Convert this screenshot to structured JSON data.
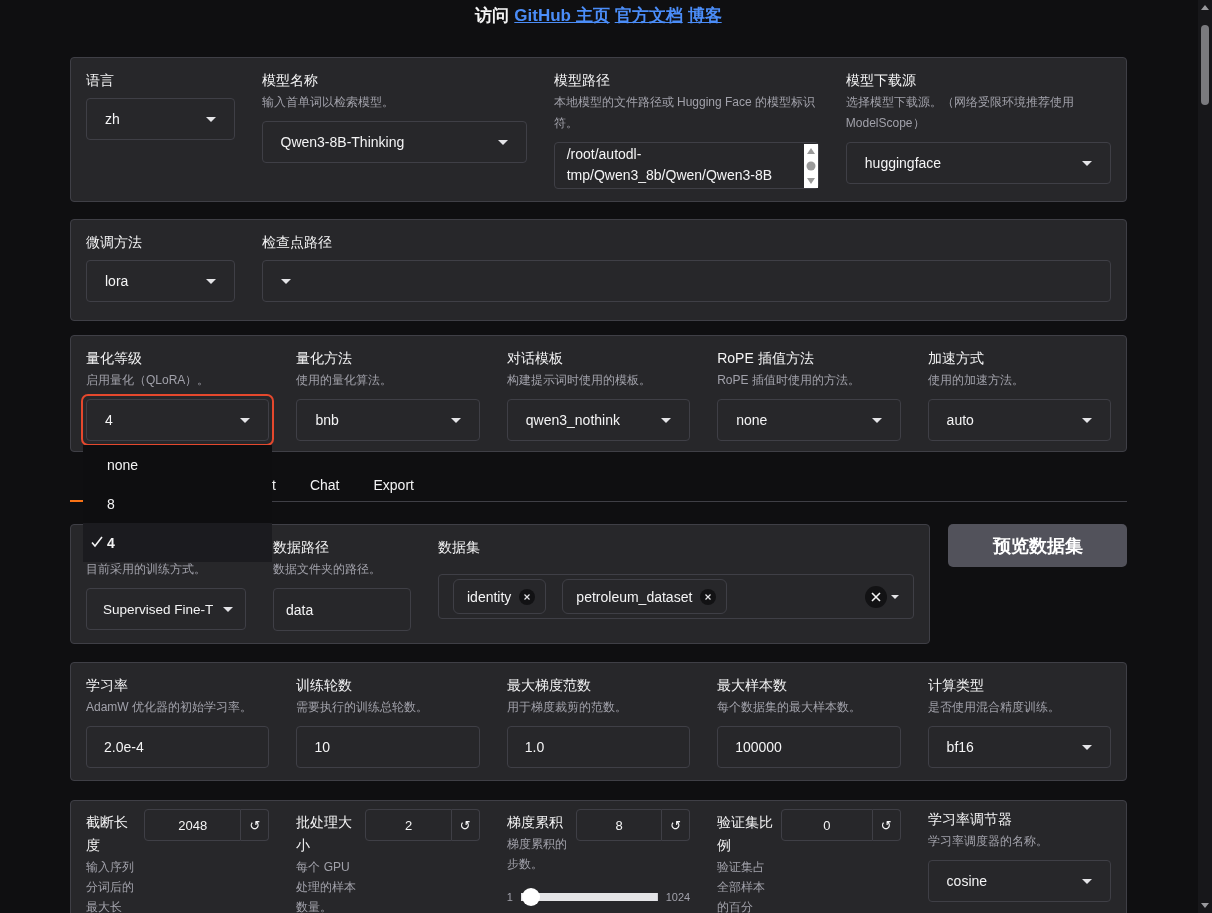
{
  "header": {
    "text": "访问",
    "links": [
      "GitHub 主页",
      "官方文档",
      "博客"
    ]
  },
  "config_panels": [
    {
      "fields": [
        {
          "kind": "select",
          "label": "语言",
          "value": "zh"
        },
        {
          "kind": "select",
          "label": "模型名称",
          "description": "输入首单词以检索模型。",
          "value": "Qwen3-8B-Thinking"
        },
        {
          "kind": "textarea",
          "label": "模型路径",
          "description": "本地模型的文件路径或 Hugging Face 的模型标识符。",
          "value": "/root/autodl-tmp/Qwen3_8b/Qwen/Qwen3-8B"
        },
        {
          "kind": "select",
          "label": "模型下载源",
          "description": "选择模型下载源。（网络受限环境推荐使用 ModelScope）",
          "value": "huggingface"
        }
      ]
    },
    {
      "fields": [
        {
          "kind": "select",
          "label": "微调方法",
          "value": "lora"
        },
        {
          "kind": "select",
          "label": "检查点路径"
        }
      ]
    },
    {
      "fields": [
        {
          "kind": "select",
          "label": "量化等级",
          "description": "启用量化（QLoRA）。",
          "value": "4",
          "highlighted": true,
          "open": true,
          "options": [
            {
              "label": "none",
              "selected": false
            },
            {
              "label": "8",
              "selected": false
            },
            {
              "label": "4",
              "selected": true
            }
          ]
        },
        {
          "kind": "select",
          "label": "量化方法",
          "description": "使用的量化算法。",
          "value": "bnb"
        },
        {
          "kind": "select",
          "label": "对话模板",
          "description": "构建提示词时使用的模板。",
          "value": "qwen3_nothink"
        },
        {
          "kind": "select",
          "label": "RoPE 插值方法",
          "description": "RoPE 插值时使用的方法。",
          "value": "none"
        },
        {
          "kind": "select",
          "label": "加速方式",
          "description": "使用的加速方法。",
          "value": "auto"
        }
      ]
    }
  ],
  "tabs": [
    {
      "selected": true
    },
    {
      "label": "t",
      "selected": false
    },
    {
      "label": "Chat",
      "selected": false
    },
    {
      "label": "Export",
      "selected": false
    }
  ],
  "data_row": {
    "fields": [
      {
        "kind": "select",
        "description": "目前采用的训练方式。",
        "value": "Supervised Fine-T"
      },
      {
        "kind": "text",
        "label": "数据路径",
        "description": "数据文件夹的路径。",
        "value": "data"
      },
      {
        "kind": "multiselect",
        "label": "数据集",
        "chips": [
          "identity",
          "petroleum_dataset"
        ]
      }
    ],
    "button": "预览数据集"
  },
  "train_panels": [
    {
      "fields": [
        {
          "kind": "text",
          "label": "学习率",
          "description": "AdamW 优化器的初始学习率。",
          "value": "2.0e-4"
        },
        {
          "kind": "text",
          "label": "训练轮数",
          "description": "需要执行的训练总轮数。",
          "value": "10"
        },
        {
          "kind": "text",
          "label": "最大梯度范数",
          "description": "用于梯度裁剪的范数。",
          "value": "1.0"
        },
        {
          "kind": "text",
          "label": "最大样本数",
          "description": "每个数据集的最大样本数。",
          "value": "100000"
        },
        {
          "kind": "select",
          "label": "计算类型",
          "description": "是否使用混合精度训练。",
          "value": "bf16"
        }
      ]
    },
    {
      "fields": [
        {
          "kind": "number",
          "label": "截断长度",
          "description": "输入序列分词后的最大长",
          "value": "2048",
          "reset": "↺"
        },
        {
          "kind": "number",
          "label": "批处理大小",
          "description": "每个 GPU 处理的样本数量。",
          "value": "2",
          "reset": "↺"
        },
        {
          "kind": "number",
          "label": "梯度累积",
          "description": "梯度累积的步数。",
          "value": "8",
          "reset": "↺",
          "slider": {
            "min": "1",
            "max": "1024",
            "level": 0.007
          }
        },
        {
          "kind": "number",
          "label": "验证集比例",
          "description": "验证集占全部样本的百分",
          "value": "0",
          "reset": "↺"
        },
        {
          "kind": "select",
          "label": "学习率调节器",
          "description": "学习率调度器的名称。",
          "value": "cosine"
        }
      ]
    }
  ]
}
